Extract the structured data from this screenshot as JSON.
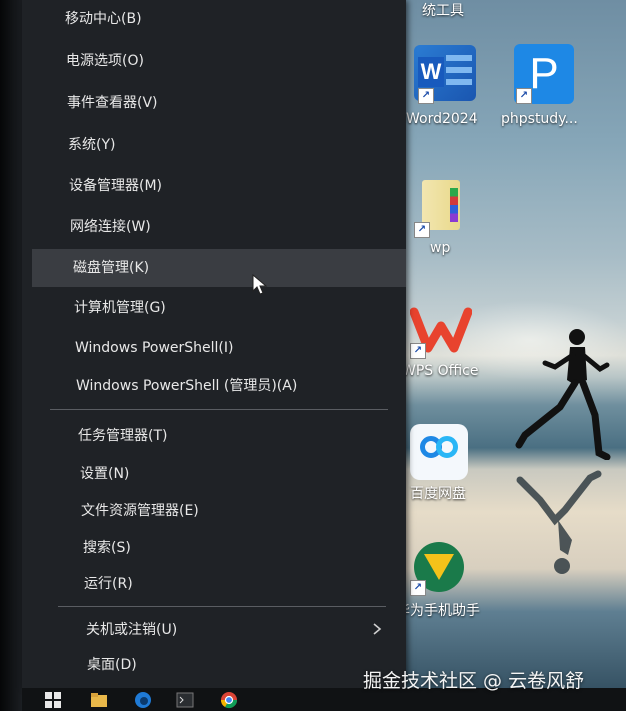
{
  "context_menu": {
    "items": [
      {
        "label": "移动中心(B)"
      },
      {
        "label": "电源选项(O)"
      },
      {
        "label": "事件查看器(V)"
      },
      {
        "label": "系统(Y)"
      },
      {
        "label": "设备管理器(M)"
      },
      {
        "label": "网络连接(W)"
      },
      {
        "label": "磁盘管理(K)"
      },
      {
        "label": "计算机管理(G)"
      },
      {
        "label": "Windows PowerShell(I)"
      },
      {
        "label": "Windows PowerShell (管理员)(A)"
      },
      {
        "label": "任务管理器(T)"
      },
      {
        "label": "设置(N)"
      },
      {
        "label": "文件资源管理器(E)"
      },
      {
        "label": "搜索(S)"
      },
      {
        "label": "运行(R)"
      },
      {
        "label": "关机或注销(U)"
      },
      {
        "label": "桌面(D)"
      }
    ],
    "highlighted_item": "磁盘管理(K)",
    "background_color": "#1f2226",
    "highlight_color": "#3a3d42"
  },
  "desktop_icons": {
    "top_partial": "统工具",
    "word": "Word2024",
    "phpstudy": "phpstudy...",
    "wp": "wp",
    "wps": "WPS Office",
    "baidu": "百度网盘",
    "huawei": "华为手机助手"
  },
  "taskbar": {
    "icons": [
      "windows-start-icon",
      "file-explorer-icon",
      "edge-icon",
      "terminal-icon",
      "chrome-icon"
    ]
  },
  "watermark": "掘金技术社区 @ 云卷风舒"
}
